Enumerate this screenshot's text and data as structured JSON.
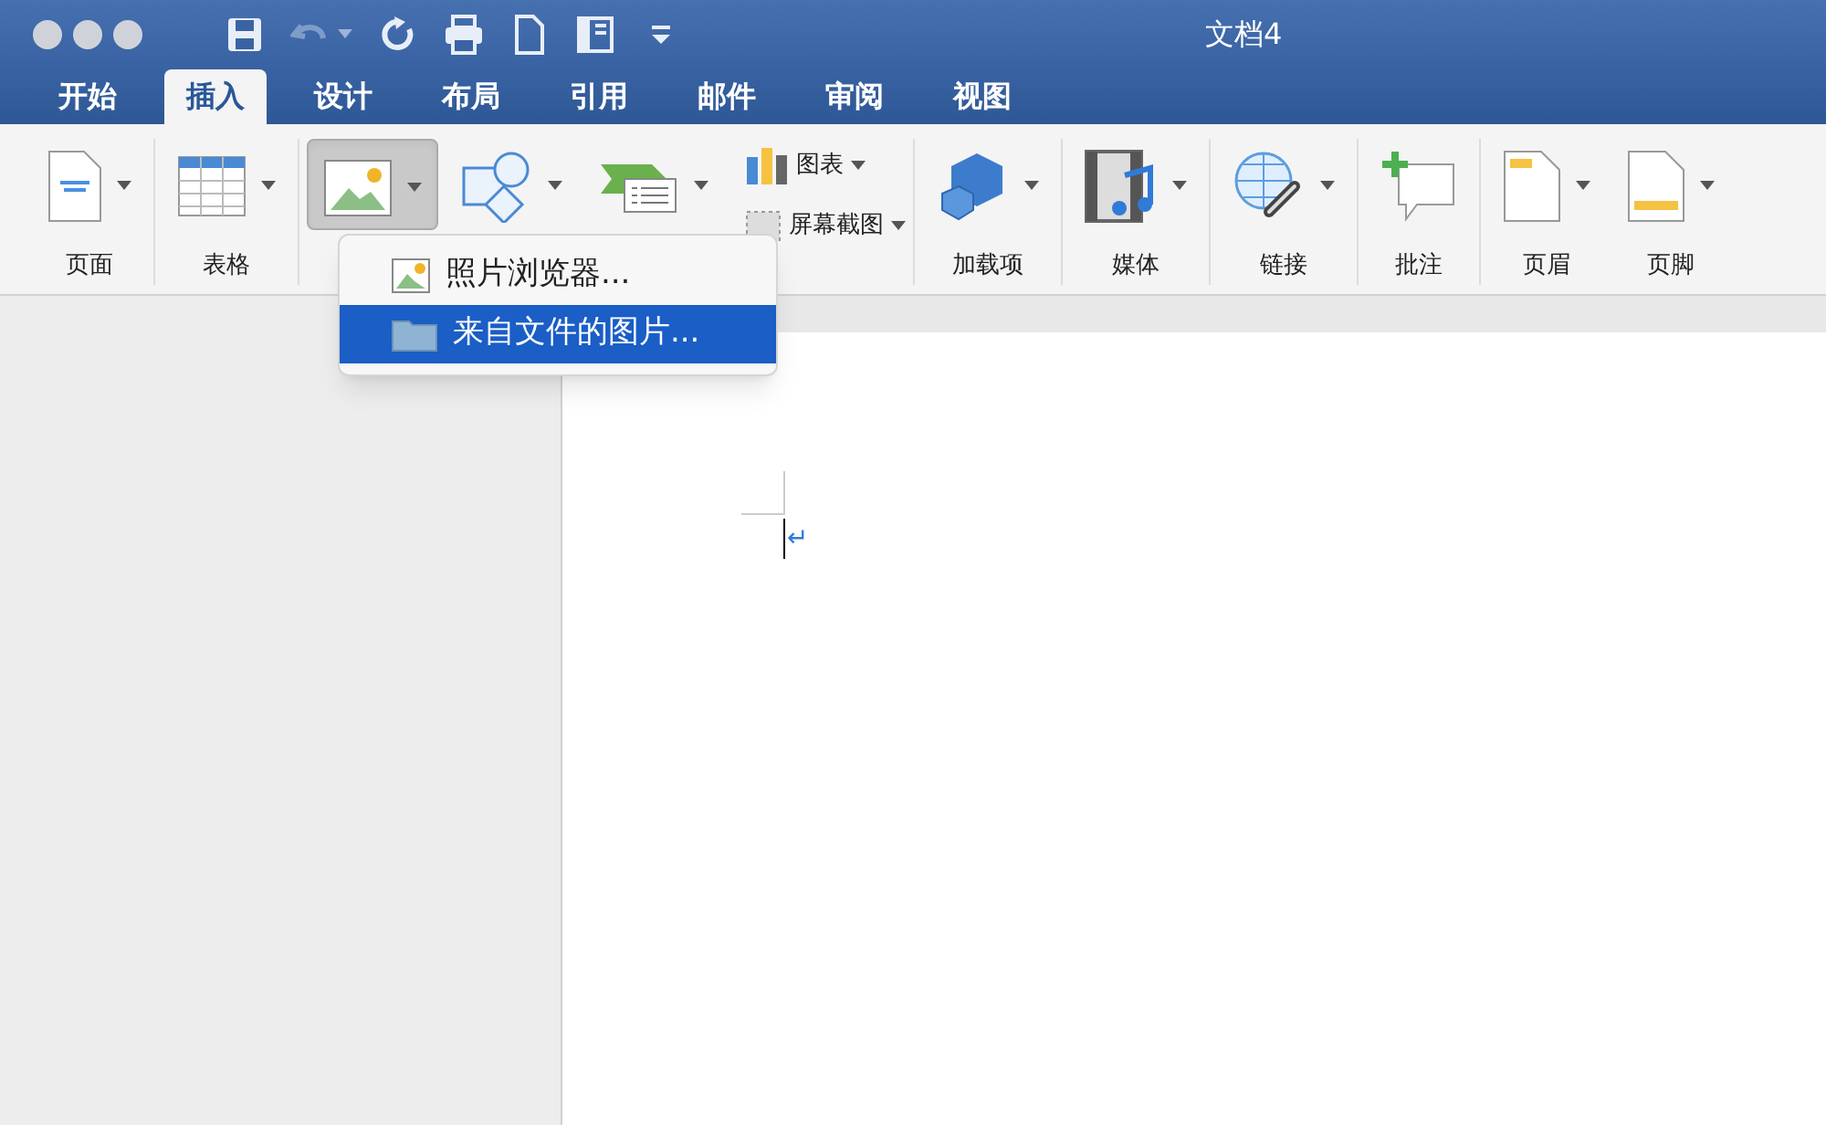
{
  "window": {
    "title": "文档4"
  },
  "quick_access": [
    {
      "kind": "save",
      "disabled": false,
      "has_menu": false
    },
    {
      "kind": "undo",
      "disabled": true,
      "has_menu": true
    },
    {
      "kind": "redo",
      "disabled": false,
      "has_menu": false
    },
    {
      "kind": "print",
      "disabled": false,
      "has_menu": false
    },
    {
      "kind": "new",
      "disabled": false,
      "has_menu": false
    },
    {
      "kind": "sidebar",
      "disabled": false,
      "has_menu": false
    },
    {
      "kind": "customize",
      "disabled": false,
      "has_menu": false
    }
  ],
  "tabs": [
    {
      "label": "开始",
      "selected": false
    },
    {
      "label": "插入",
      "selected": true
    },
    {
      "label": "设计",
      "selected": false
    },
    {
      "label": "布局",
      "selected": false
    },
    {
      "label": "引用",
      "selected": false
    },
    {
      "label": "邮件",
      "selected": false
    },
    {
      "label": "审阅",
      "selected": false
    },
    {
      "label": "视图",
      "selected": false
    }
  ],
  "ribbon": {
    "groups": [
      {
        "items": [
          {
            "kind": "page",
            "label": "页面",
            "has_menu": true,
            "pressed": false
          }
        ]
      },
      {
        "items": [
          {
            "kind": "table",
            "label": "表格",
            "has_menu": true,
            "pressed": false
          }
        ]
      },
      {
        "items": [
          {
            "kind": "picture",
            "has_menu": true,
            "pressed": true
          },
          {
            "kind": "shapes",
            "has_menu": true,
            "pressed": false
          },
          {
            "kind": "smartart",
            "has_menu": true,
            "pressed": false
          },
          {
            "kind": "stack",
            "rows": [
              {
                "kind": "chart",
                "label": "图表",
                "has_menu": true
              },
              {
                "kind": "screenshot",
                "label": "屏幕截图",
                "has_menu": true
              }
            ]
          }
        ]
      },
      {
        "items": [
          {
            "kind": "addins",
            "label": "加载项",
            "has_menu": true,
            "pressed": false
          }
        ]
      },
      {
        "items": [
          {
            "kind": "media",
            "label": "媒体",
            "has_menu": true,
            "pressed": false
          }
        ]
      },
      {
        "items": [
          {
            "kind": "link",
            "label": "链接",
            "has_menu": true,
            "pressed": false
          }
        ]
      },
      {
        "items": [
          {
            "kind": "comment",
            "label": "批注",
            "has_menu": false,
            "pressed": false
          }
        ]
      },
      {
        "items": [
          {
            "kind": "header",
            "label": "页眉",
            "has_menu": true,
            "pressed": false
          },
          {
            "kind": "footer",
            "label": "页脚",
            "has_menu": true,
            "pressed": false
          }
        ]
      }
    ]
  },
  "picture_menu": {
    "items": [
      {
        "kind": "photo",
        "label": "照片浏览器...",
        "selected": false
      },
      {
        "kind": "folder",
        "label": "来自文件的图片...",
        "selected": true
      }
    ]
  },
  "document": {
    "paragraph_mark": "↵"
  }
}
